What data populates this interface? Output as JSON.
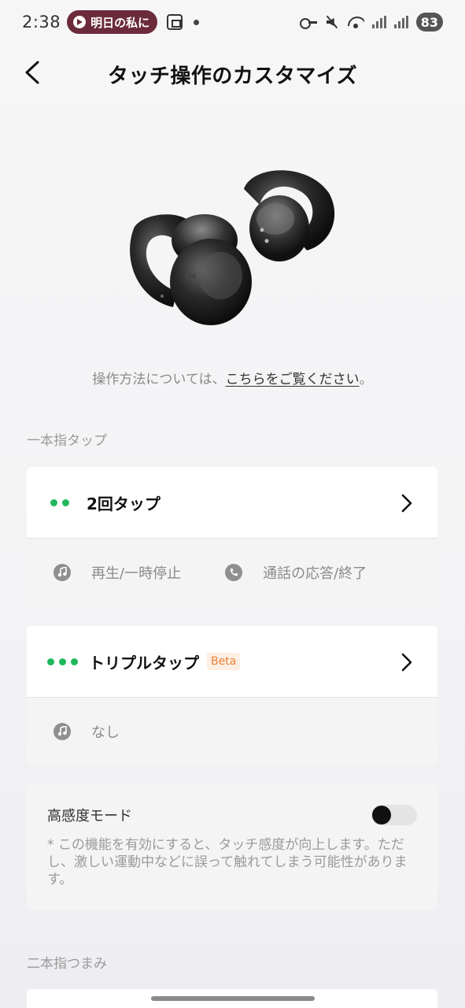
{
  "status_bar": {
    "time": "2:38",
    "notification_pill": "明日の私に",
    "battery": "83"
  },
  "nav": {
    "title": "タッチ操作のカスタマイズ"
  },
  "help": {
    "prefix": "操作方法については、",
    "link": "こちらをご覧ください",
    "suffix": "。"
  },
  "sections": {
    "one_finger": "一本指タップ",
    "two_finger": "二本指つまみ"
  },
  "gestures": [
    {
      "title": "2回タップ",
      "dots": 2,
      "actions": [
        {
          "icon": "music-note-icon",
          "label": "再生/一時停止"
        },
        {
          "icon": "phone-call-icon",
          "label": "通話の応答/終了"
        }
      ]
    },
    {
      "title": "トリプルタップ",
      "badge": "Beta",
      "dots": 3,
      "actions": [
        {
          "icon": "music-note-icon",
          "label": "なし"
        }
      ]
    }
  ],
  "sensitivity": {
    "label": "高感度モード",
    "enabled": false,
    "note": "* この機能を有効にすると、タッチ感度が向上します。ただし、激しい運動中などに誤って触れてしまう可能性があります。"
  },
  "colors": {
    "accent_green": "#1fb95c",
    "beta_orange": "#e8823a",
    "pill": "#6b2b3a"
  }
}
